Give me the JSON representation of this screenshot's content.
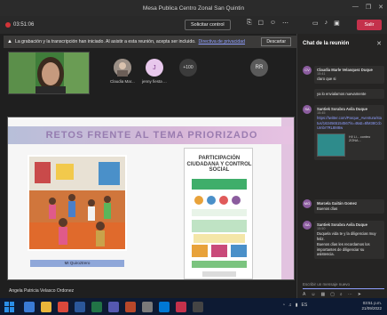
{
  "window": {
    "title": "Mesa Publica Centro Zonal San Quintin",
    "controls": [
      "—",
      "❐",
      "✕"
    ]
  },
  "toolbar": {
    "timer": "03:51:06",
    "request_control": "Solicitar control",
    "leave_label": "Salir"
  },
  "banner": {
    "text": "La grabación y la transcripción han iniciado. Al asistir a esta reunión, acepta ser incluido.",
    "privacy_link": "Directiva de privacidad",
    "dismiss": "Descartar"
  },
  "participants": [
    {
      "name": "Claudia Mar...",
      "initials": ""
    },
    {
      "name": "jenny fiesta ...",
      "initials": "J"
    },
    {
      "name": "",
      "initials": "+100"
    },
    {
      "name": "",
      "initials": "RR"
    }
  ],
  "slide": {
    "title": "RETOS FRENTE AL TEMA PRIORIZADO",
    "photo_caption": "MI Quiroztrero",
    "poster_title": "PARTICIPACIÓN CIUDADANA Y CONTROL SOCIAL"
  },
  "presenter": {
    "name": "Angela Patricia Velasco Ordonez"
  },
  "chat": {
    "title": "Chat de la reunión",
    "messages": [
      {
        "initials": "CV",
        "author": "Claudia Marle Velasquez Duque",
        "time": "15:41",
        "text": "claro que si"
      },
      {
        "initials": "",
        "author": "",
        "time": "",
        "text": "ya lo envialamos nuevamente"
      },
      {
        "initials": "SA",
        "author": "Santiek Sorabra Avila Duque",
        "time": "15:45",
        "link": "https://twitter.com/Parque_Aventura/status/1634565154567/s=46&t=8lM38CcbUmbr7RL8M8w",
        "attach_caption": "Hi! Li... conteo ZONA..."
      },
      {
        "initials": "MG",
        "author": "Marcela Gaitán Gomez",
        "time": "15:48",
        "text": "Buenos días"
      },
      {
        "initials": "SA",
        "author": "Santiek Sorabra Avila Duque",
        "time": "15:50",
        "text": "Duquela vida te y la diligencias muy feliz.",
        "text2": "Buenos días les recordamos los importantes de diligenciar su asistencia."
      }
    ],
    "compose_placeholder": "Escribir un mensaje nuevo"
  },
  "taskbar": {
    "time": "03:51 p.m.",
    "date": "21/09/2022"
  }
}
